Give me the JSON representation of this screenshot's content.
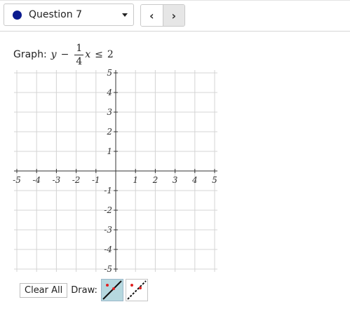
{
  "header": {
    "question_label": "Question 7",
    "prev_symbol": "‹",
    "next_symbol": "›",
    "question_dot_color": "#0b1b8f"
  },
  "prompt": {
    "label": "Graph:",
    "lhs_var": "y",
    "minus": "−",
    "frac_num": "1",
    "frac_den": "4",
    "x_var": "x",
    "relation": "≤",
    "rhs": "2"
  },
  "graph": {
    "x_ticks": [
      "-5",
      "-4",
      "-3",
      "-2",
      "-1",
      "1",
      "2",
      "3",
      "4",
      "5"
    ],
    "y_ticks": [
      "5",
      "4",
      "3",
      "2",
      "1",
      "-1",
      "-2",
      "-3",
      "-4",
      "-5"
    ],
    "xlim": [
      -5,
      5
    ],
    "ylim": [
      -5,
      5
    ],
    "grid": true
  },
  "toolbar": {
    "clear_label": "Clear All",
    "draw_label": "Draw:",
    "tools": [
      {
        "name": "solid-line",
        "active": true
      },
      {
        "name": "dashed-line",
        "active": false
      }
    ]
  }
}
